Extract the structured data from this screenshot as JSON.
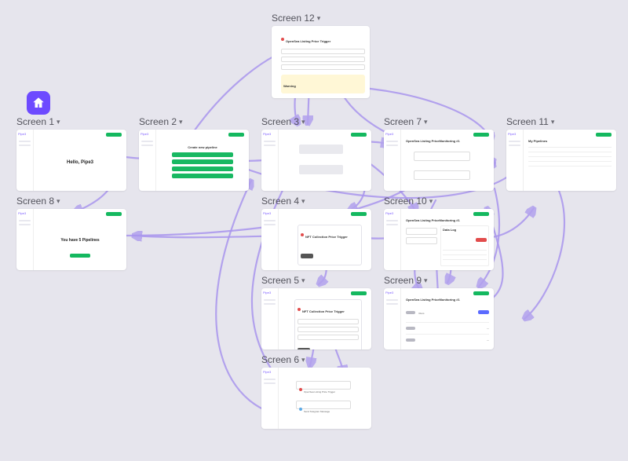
{
  "accent_color": "#6d4aff",
  "flow_color": "#a996ee",
  "success_color": "#14b85f",
  "danger_color": "#e24c4c",
  "warning_bg": "#fff7d6",
  "screens": {
    "s1": {
      "label": "Screen 1",
      "content": {
        "title": "Hello, Pipe3",
        "sidebar_brand": "Pipe3",
        "top_button": true
      }
    },
    "s2": {
      "label": "Screen 2",
      "content": {
        "title": "Create new pipeline",
        "sidebar_brand": "Pipe3",
        "top_button": true
      }
    },
    "s3": {
      "label": "Screen 3",
      "content": {
        "sidebar_brand": "Pipe3",
        "top_button": true
      }
    },
    "s4": {
      "label": "Screen 4",
      "content": {
        "sidebar_brand": "Pipe3",
        "panel_title": "NFT Collection Price Trigger",
        "top_button": true
      }
    },
    "s5": {
      "label": "Screen 5",
      "content": {
        "sidebar_brand": "Pipe3",
        "panel_title": "NFT Collection Price Trigger",
        "top_button": true
      }
    },
    "s6": {
      "label": "Screen 6",
      "content": {
        "sidebar_brand": "Pipe3",
        "trigger_label": "OpenSea Listing Price Trigger",
        "action_label": "Send Telegram Message"
      }
    },
    "s7": {
      "label": "Screen 7",
      "content": {
        "sidebar_brand": "Pipe3",
        "page_title": "OpenSea Listing PriceMonitoring #1",
        "top_button": true
      }
    },
    "s8": {
      "label": "Screen 8",
      "content": {
        "sidebar_brand": "Pipe3",
        "headline": "You have 5 Pipelines",
        "top_button": true
      }
    },
    "s9": {
      "label": "Screen 9",
      "content": {
        "sidebar_brand": "Pipe3",
        "page_title": "OpenSea Listing PriceMonitoring #1",
        "tabs": [
          "Runs"
        ],
        "top_button": true
      }
    },
    "s10": {
      "label": "Screen 10",
      "content": {
        "sidebar_brand": "Pipe3",
        "page_title": "OpenSea Listing PriceMonitoring #1",
        "panel_title": "Data Log",
        "top_button": true
      }
    },
    "s11": {
      "label": "Screen 11",
      "content": {
        "sidebar_brand": "Pipe3",
        "page_title": "My Pipelines",
        "top_button": true
      }
    },
    "s12": {
      "label": "Screen 12",
      "content": {
        "trigger_label": "OpenSea Listing Price Trigger",
        "warning": "Warning"
      }
    }
  },
  "icons": {
    "home": "home-icon",
    "chevron": "chevron-down-icon"
  }
}
